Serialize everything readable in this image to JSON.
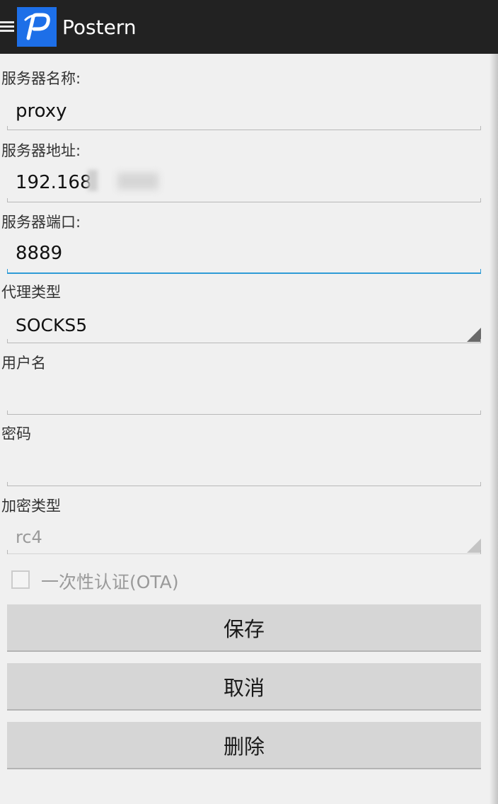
{
  "app": {
    "title": "Postern",
    "logo_letter": "P"
  },
  "form": {
    "server_name": {
      "label": "服务器名称:",
      "value": "proxy"
    },
    "server_address": {
      "label": "服务器地址:",
      "value": "192.168"
    },
    "server_port": {
      "label": "服务器端口:",
      "value": "8889"
    },
    "proxy_type": {
      "label": "代理类型",
      "value": "SOCKS5"
    },
    "username": {
      "label": "用户名",
      "value": ""
    },
    "password": {
      "label": "密码",
      "value": ""
    },
    "encryption_type": {
      "label": "加密类型",
      "value": "rc4"
    },
    "ota": {
      "label": "一次性认证(OTA)",
      "checked": false
    }
  },
  "buttons": {
    "save": "保存",
    "cancel": "取消",
    "delete": "删除"
  },
  "colors": {
    "actionbar": "#222222",
    "logo_bg": "#1d6fe8",
    "focus": "#2f9bd6",
    "button_bg": "#d6d6d6"
  },
  "icons": {
    "menu": "menu-icon",
    "spinner": "spinner-arrow-icon",
    "checkbox": "checkbox-icon"
  }
}
